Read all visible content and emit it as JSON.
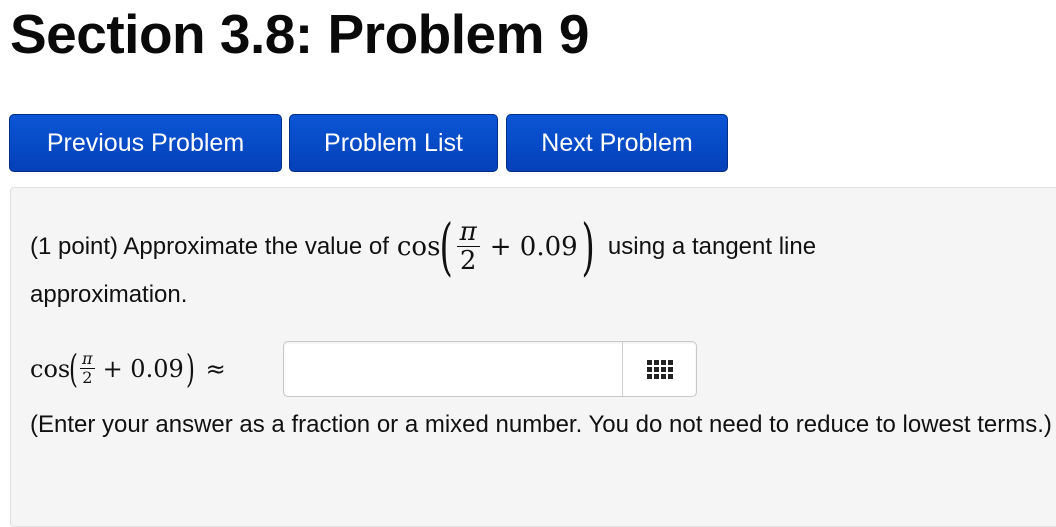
{
  "page": {
    "title": "Section 3.8: Problem 9"
  },
  "nav": {
    "previous_label": "Previous Problem",
    "list_label": "Problem List",
    "next_label": "Next Problem"
  },
  "problem": {
    "intro": "(1 point) Approximate the value of",
    "math_fn": "cos",
    "math_num": "π",
    "math_den": "2",
    "math_plus": "+ 0.09",
    "paren_open": "(",
    "paren_close": ")",
    "after_math": "using a tangent line",
    "line2": "approximation.",
    "answer_approx": "≈",
    "answer_value": "",
    "answer_placeholder": "",
    "palette_icon": "grid-icon",
    "hint": "(Enter your answer as a fraction or a mixed number. You do not need to reduce to lowest terms.)"
  },
  "colors": {
    "button_blue": "#0548c8",
    "panel_bg": "#f5f5f5"
  }
}
